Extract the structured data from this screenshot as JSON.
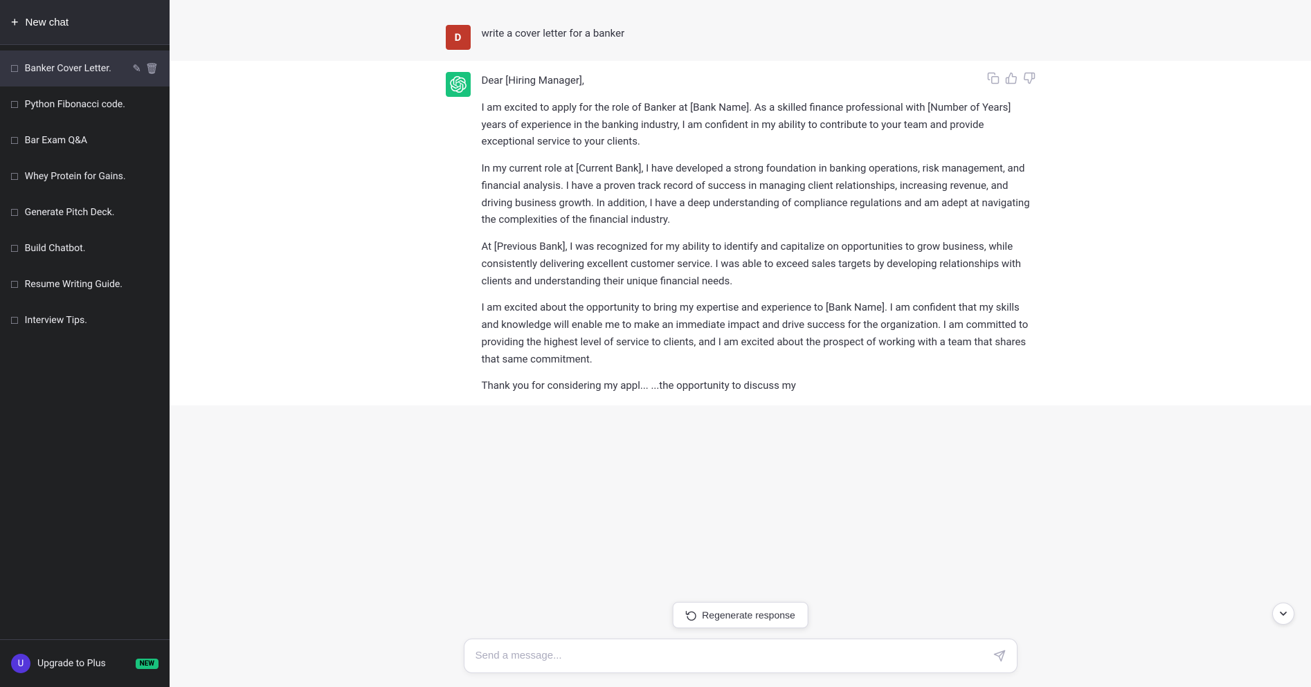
{
  "sidebar": {
    "new_chat_label": "New chat",
    "items": [
      {
        "id": "banker",
        "label": "Banker Cover Letter.",
        "active": true,
        "show_actions": true
      },
      {
        "id": "fibonacci",
        "label": "Python Fibonacci code.",
        "active": false,
        "show_actions": false
      },
      {
        "id": "barexam",
        "label": "Bar Exam Q&A",
        "active": false,
        "show_actions": false
      },
      {
        "id": "whey",
        "label": "Whey Protein for Gains.",
        "active": false,
        "show_actions": false
      },
      {
        "id": "pitch",
        "label": "Generate Pitch Deck.",
        "active": false,
        "show_actions": false
      },
      {
        "id": "chatbot",
        "label": "Build Chatbot.",
        "active": false,
        "show_actions": false
      },
      {
        "id": "resume",
        "label": "Resume Writing Guide.",
        "active": false,
        "show_actions": false
      },
      {
        "id": "interview",
        "label": "Interview Tips.",
        "active": false,
        "show_actions": false
      }
    ],
    "footer": {
      "upgrade_label": "Upgrade to Plus",
      "new_badge": "NEW"
    }
  },
  "chat": {
    "user_message": "write a cover letter for a banker",
    "user_avatar": "D",
    "assistant_avatar_alt": "ChatGPT",
    "paragraphs": [
      "Dear [Hiring Manager],",
      "I am excited to apply for the role of Banker at [Bank Name]. As a skilled finance professional with [Number of Years] years of experience in the banking industry, I am confident in my ability to contribute to your team and provide exceptional service to your clients.",
      "In my current role at [Current Bank], I have developed a strong foundation in banking operations, risk management, and financial analysis. I have a proven track record of success in managing client relationships, increasing revenue, and driving business growth. In addition, I have a deep understanding of compliance regulations and am adept at navigating the complexities of the financial industry.",
      "At [Previous Bank], I was recognized for my ability to identify and capitalize on opportunities to grow business, while consistently delivering excellent customer service. I was able to exceed sales targets by developing relationships with clients and understanding their unique financial needs.",
      "I am excited about the opportunity to bring my expertise and experience to [Bank Name]. I am confident that my skills and knowledge will enable me to make an immediate impact and drive success for the organization. I am committed to providing the highest level of service to clients, and I am excited about the prospect of working with a team that shares that same commitment.",
      "Thank you for considering my appl... ...the opportunity to discuss my"
    ]
  },
  "input": {
    "placeholder": "Send a message..."
  },
  "regenerate": {
    "label": "Regenerate response"
  }
}
